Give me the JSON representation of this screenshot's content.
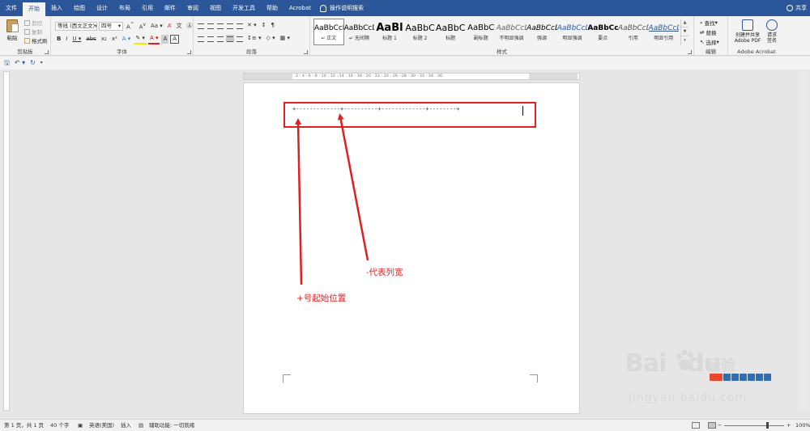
{
  "tabs": [
    "文件",
    "开始",
    "插入",
    "绘图",
    "设计",
    "布局",
    "引用",
    "邮件",
    "审阅",
    "视图",
    "开发工具",
    "帮助",
    "Acrobat"
  ],
  "active_tab": "开始",
  "tell_me": "操作说明搜索",
  "share_label": "共享",
  "clipboard": {
    "paste": "粘贴",
    "cut": "剪切",
    "copy": "复制",
    "format_painter": "格式刷",
    "label": "剪贴板"
  },
  "font": {
    "name": "等线 (西文正文)",
    "size": "四号",
    "label": "字体"
  },
  "paragraph": {
    "label": "段落"
  },
  "styles": {
    "label": "样式",
    "items": [
      {
        "sample": "AaBbCcDd",
        "name": "正文"
      },
      {
        "sample": "AaBbCcDd",
        "name": "无间隔"
      },
      {
        "sample": "AaBl",
        "name": "标题 1"
      },
      {
        "sample": "AaBbC",
        "name": "标题 2"
      },
      {
        "sample": "AaBbC",
        "name": "标题"
      },
      {
        "sample": "AaBbC",
        "name": "副标题"
      },
      {
        "sample": "AaBbCcDd",
        "name": "不明显强调"
      },
      {
        "sample": "AaBbCcDd",
        "name": "强调"
      },
      {
        "sample": "AaBbCcDd",
        "name": "明显强调"
      },
      {
        "sample": "AaBbCcDd",
        "name": "要点"
      },
      {
        "sample": "AaBbCcDd",
        "name": "引用"
      },
      {
        "sample": "AaBbCcDd",
        "name": "明显引用"
      }
    ]
  },
  "editing": {
    "find": "查找",
    "replace": "替换",
    "select": "选择",
    "label": "编辑"
  },
  "acrobat": {
    "create_share": "创建并共享",
    "adobe_pdf": "Adobe PDF",
    "request": "请求",
    "sign": "签名",
    "label": "Adobe Acrobat"
  },
  "ruler_ticks": "2 · 4 · 6 · 8 · 10 · 12 · 14 · 16 · 18 · 20 · 22 · 24 · 26 · 28 · 30 · 32 · 34 · 36",
  "document": {
    "tab_line": "+-------------+----------+-------------+--------+",
    "annotation_plus": "+号起始位置",
    "annotation_dash": "-代表列宽"
  },
  "watermark": {
    "logo": "Bai",
    "logo2": "du",
    "brand": "经验",
    "url": "jingyan.baidu.com"
  },
  "status": {
    "page": "第 1 页，共 1 页",
    "words": "40 个字",
    "language": "英语(美国)",
    "mode": "插入",
    "accessibility": "辅助功能: 一切就绪",
    "zoom": "100%"
  },
  "colors": {
    "accent": "#2b579a",
    "annotation": "#e02020"
  }
}
